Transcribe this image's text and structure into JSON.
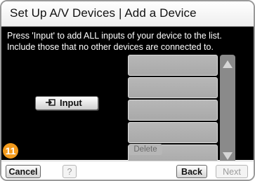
{
  "dialog": {
    "title": "Set Up A/V Devices | Add a Device",
    "instructions": [
      "Press 'Input' to add ALL inputs of your device to the list.",
      "Include those that no other devices are connected to."
    ]
  },
  "input_button": {
    "label": "Input",
    "icon": "input-connector-icon"
  },
  "input_list": {
    "slots": [
      "",
      "",
      "",
      "",
      ""
    ]
  },
  "delete_button": {
    "label": "Delete"
  },
  "footer": {
    "cancel_label": "Cancel",
    "help_label": "?",
    "back_label": "Back",
    "next_label": "Next"
  },
  "step_badge": "11",
  "colors": {
    "badge": "#f29a1c",
    "panel": "#000000"
  }
}
